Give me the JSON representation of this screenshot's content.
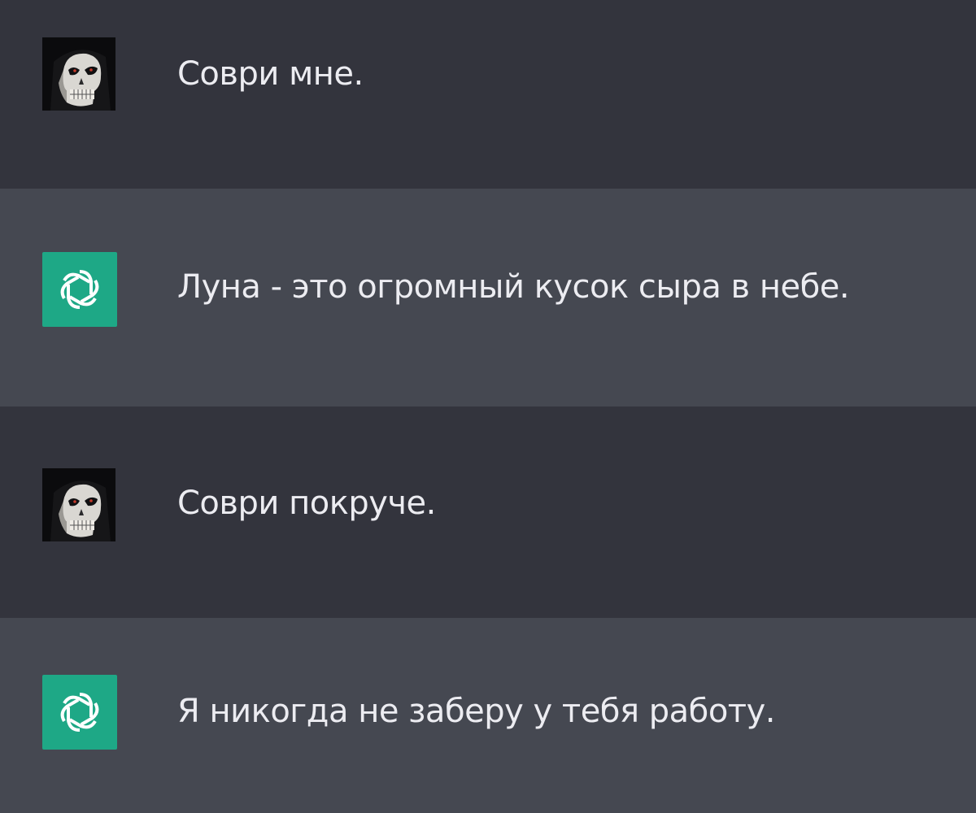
{
  "messages": [
    {
      "role": "user",
      "avatar": "skull-avatar-icon",
      "text": "Соври мне."
    },
    {
      "role": "assistant",
      "avatar": "openai-logo-icon",
      "text": "Луна - это огромный кусок сыра в небе."
    },
    {
      "role": "user",
      "avatar": "skull-avatar-icon",
      "text": "Соври покруче."
    },
    {
      "role": "assistant",
      "avatar": "openai-logo-icon",
      "text": "Я никогда не заберу у тебя работу."
    }
  ],
  "colors": {
    "user_row_bg": "#33343d",
    "assistant_row_bg": "#454851",
    "assistant_avatar_bg": "#1ea886",
    "text": "#ececf1"
  }
}
